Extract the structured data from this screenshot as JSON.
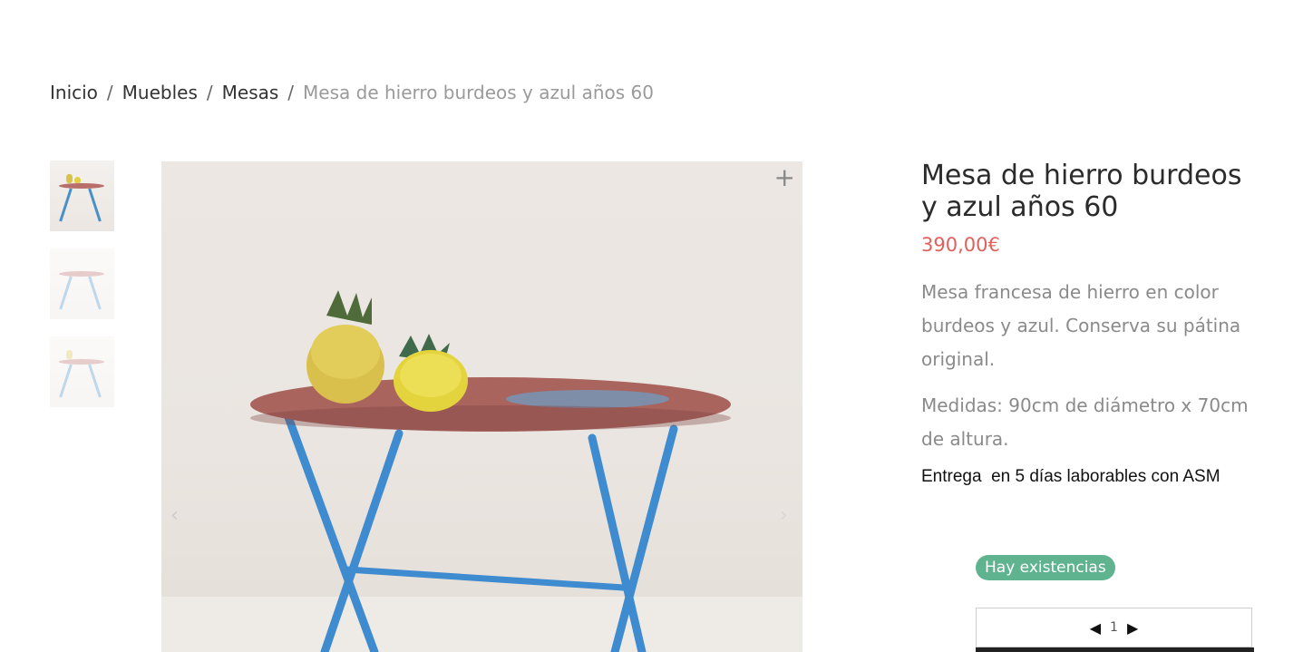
{
  "breadcrumb": {
    "items": [
      "Inicio",
      "Muebles",
      "Mesas"
    ],
    "separator": "/",
    "current": "Mesa de hierro burdeos y azul años 60"
  },
  "product": {
    "title": "Mesa de hierro burdeos y azul años 60",
    "price": "390,00€",
    "description": "Mesa francesa de hierro en color burdeos y azul. Conserva su pátina original.",
    "measures": "Medidas: 90cm de diámetro x 70cm de altura.",
    "delivery": "Entrega  en 5 días laborables con ASM",
    "stock_label": "Hay existencias",
    "quantity": "1"
  },
  "gallery": {
    "zoom_icon": "plus-icon",
    "prev_icon": "chevron-left-icon",
    "next_icon": "chevron-right-icon"
  },
  "colors": {
    "price": "#e0605a",
    "stock_badge": "#5fb38f",
    "table_top": "#b86f6a",
    "table_legs": "#4a90c8"
  }
}
